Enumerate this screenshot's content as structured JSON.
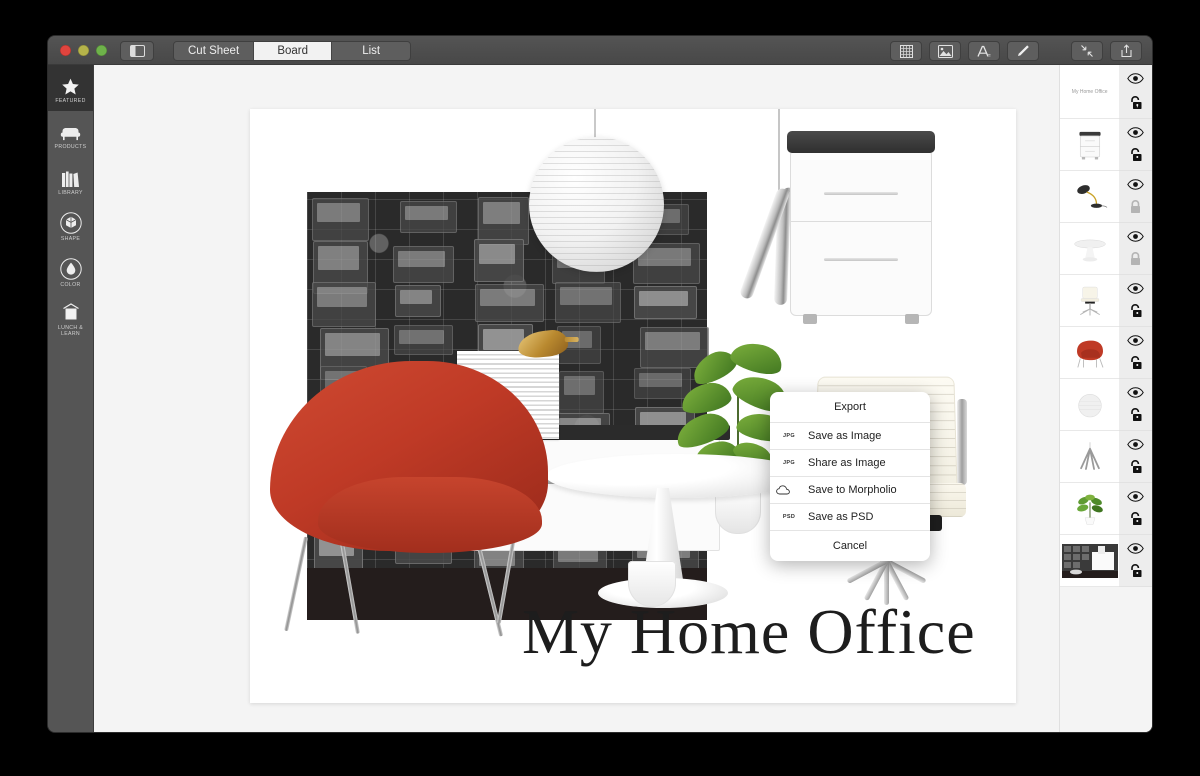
{
  "window": {
    "traffic_lights": [
      "close",
      "minimize",
      "zoom"
    ],
    "sidebar_toggle_icon": "sidebar-panel-icon"
  },
  "segmented_control": {
    "active": "Board",
    "options": [
      {
        "label": "Cut Sheet",
        "active": false
      },
      {
        "label": "Board",
        "active": true
      },
      {
        "label": "List",
        "active": false
      }
    ]
  },
  "toolbar": {
    "tools": [
      {
        "name": "grid-icon",
        "label": "Grid"
      },
      {
        "name": "image-icon",
        "label": "Image"
      },
      {
        "name": "text-icon",
        "label": "Text"
      },
      {
        "name": "pen-icon",
        "label": "Draw"
      }
    ],
    "actions": [
      {
        "name": "collapse-icon",
        "label": "Collapse"
      },
      {
        "name": "share-icon",
        "label": "Share"
      }
    ]
  },
  "sidebar": {
    "items": [
      {
        "label": "Featured",
        "icon": "star-icon",
        "active": true
      },
      {
        "label": "Products",
        "icon": "sofa-icon",
        "active": false
      },
      {
        "label": "Library",
        "icon": "books-icon",
        "active": false
      },
      {
        "label": "Shape",
        "icon": "cube-icon",
        "active": false
      },
      {
        "label": "Color",
        "icon": "droplet-icon",
        "active": false
      },
      {
        "label": "Lunch & Learn",
        "icon": "projector-icon",
        "active": false
      }
    ]
  },
  "board": {
    "title": "My Home Office",
    "background_color": "#ffffff",
    "accent_color": "#bf3a26"
  },
  "export_popover": {
    "title": "Export",
    "items": [
      {
        "icon_label": "JPG",
        "label": "Save as Image"
      },
      {
        "icon_label": "JPG",
        "label": "Share as Image"
      },
      {
        "icon_label": "cloud-icon",
        "label": "Save to Morpholio"
      },
      {
        "icon_label": "PSD",
        "label": "Save as PSD"
      }
    ],
    "cancel_label": "Cancel"
  },
  "layers": [
    {
      "label": "My Home Office",
      "type": "text",
      "visible": true,
      "locked": false
    },
    {
      "label": "File Cabinet",
      "type": "image",
      "visible": true,
      "locked": false
    },
    {
      "label": "Desk Lamp",
      "type": "image",
      "visible": true,
      "locked": true
    },
    {
      "label": "Tulip Table",
      "type": "image",
      "visible": true,
      "locked": true
    },
    {
      "label": "Office Chair",
      "type": "image",
      "visible": true,
      "locked": false
    },
    {
      "label": "Red Womb Chair",
      "type": "image",
      "visible": true,
      "locked": false
    },
    {
      "label": "Globe Pendant",
      "type": "image",
      "visible": true,
      "locked": false
    },
    {
      "label": "Tripod Lamp",
      "type": "image",
      "visible": true,
      "locked": false
    },
    {
      "label": "Fiddle Leaf Fig",
      "type": "image",
      "visible": true,
      "locked": false
    },
    {
      "label": "Background",
      "type": "image",
      "visible": true,
      "locked": false
    }
  ]
}
